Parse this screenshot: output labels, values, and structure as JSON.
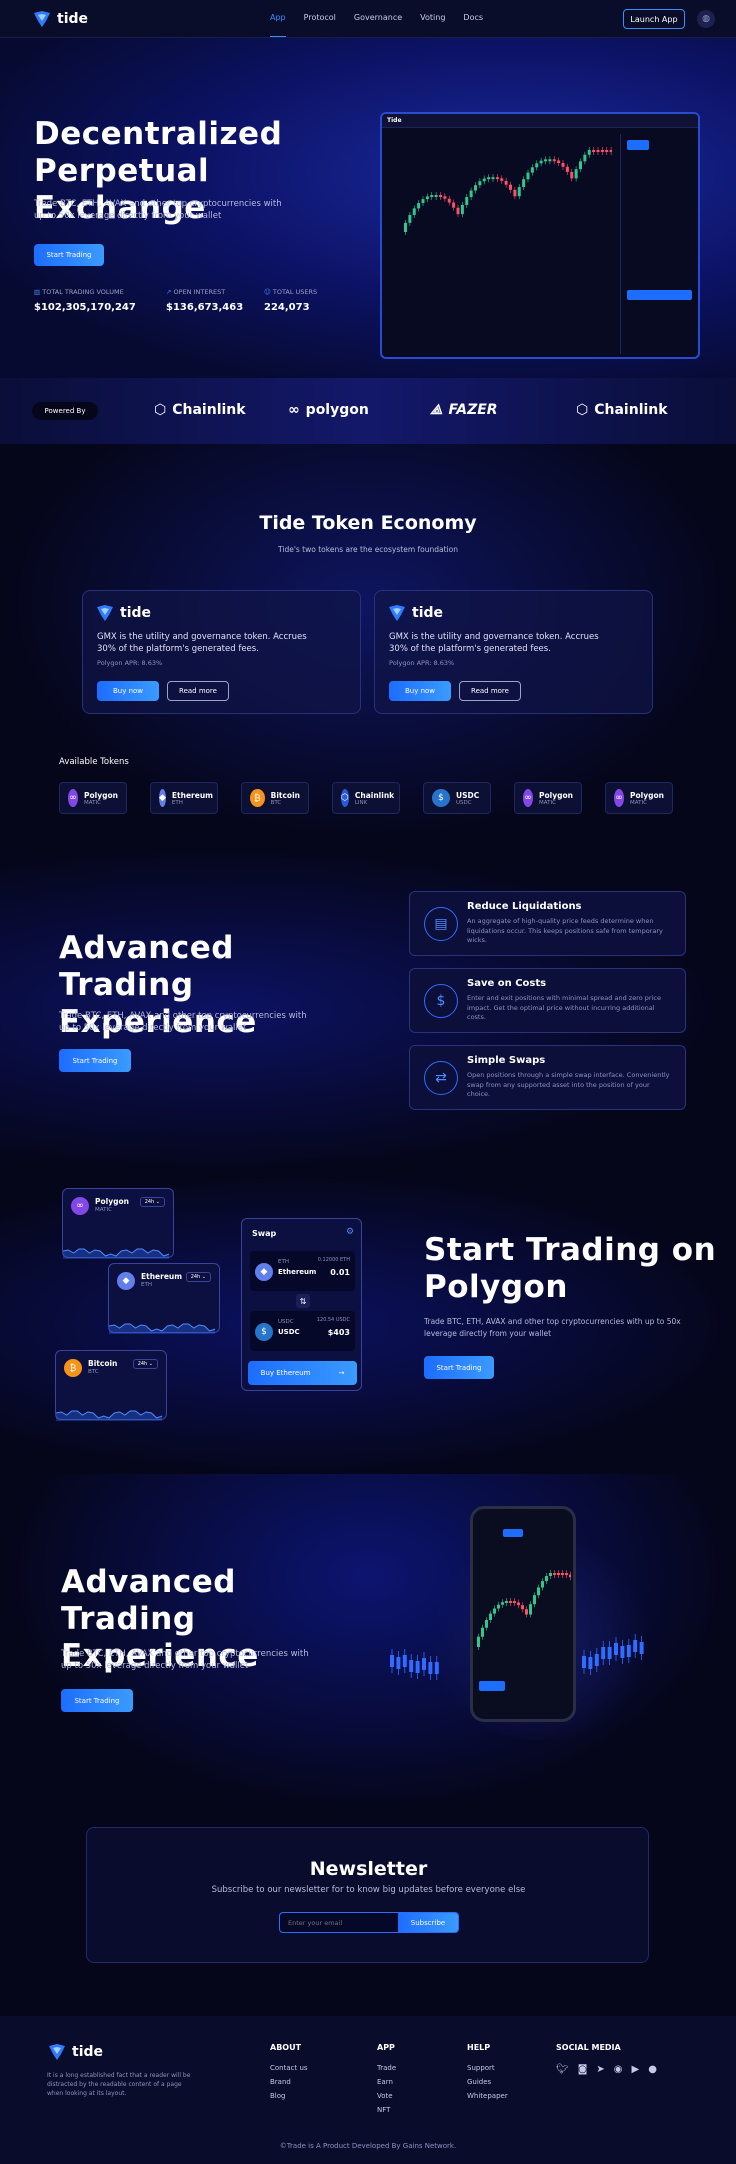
{
  "nav": {
    "brand": "tide",
    "links": [
      "App",
      "Protocol",
      "Governance",
      "Voting",
      "Docs"
    ],
    "launch": "Launch App"
  },
  "hero": {
    "title_line1": "Decentralized",
    "title_line2": "Perpetual Exchange",
    "subtitle": "Trade BTC, ETH, AVAX and other top cryptocurrencies with up to 50x leverage directly from your wallet",
    "cta": "Start Trading",
    "stats": [
      {
        "label": "TOTAL TRADING VOLUME",
        "value": "$102,305,170,247"
      },
      {
        "label": "OPEN INTEREST",
        "value": "$136,673,463"
      },
      {
        "label": "TOTAL USERS",
        "value": "224,073"
      }
    ]
  },
  "powered": {
    "label": "Powered By",
    "partners": [
      "Chainlink",
      "polygon",
      "FAZER",
      "Chainlink"
    ]
  },
  "economy": {
    "title": "Tide Token Economy",
    "subtitle": "Tide's two tokens are the ecosystem foundation",
    "cards": [
      {
        "brand": "tide",
        "desc_line1": "GMX is the utility and governance token. Accrues",
        "desc_line2": "30% of the platform's generated fees.",
        "apr": "Polygon APR: 8.63%",
        "buy": "Buy now",
        "read": "Read more"
      },
      {
        "brand": "tide",
        "desc_line1": "GMX is the utility and governance token. Accrues",
        "desc_line2": "30% of the platform's generated fees.",
        "apr": "Polygon APR: 8.63%",
        "buy": "Buy now",
        "read": "Read more"
      }
    ],
    "tokens_title": "Available Tokens",
    "tokens": [
      {
        "name": "Polygon",
        "sym": "MATIC",
        "color": "#8247e5"
      },
      {
        "name": "Ethereum",
        "sym": "ETH",
        "color": "#627eea"
      },
      {
        "name": "Bitcoin",
        "sym": "BTC",
        "color": "#f7931a"
      },
      {
        "name": "Chainlink",
        "sym": "LINK",
        "color": "#2a5ada"
      },
      {
        "name": "USDC",
        "sym": "USDC",
        "color": "#2775ca"
      },
      {
        "name": "Polygon",
        "sym": "MATIC",
        "color": "#8247e5"
      },
      {
        "name": "Polygon",
        "sym": "MATIC",
        "color": "#8247e5"
      }
    ]
  },
  "advanced": {
    "title_line1": "Advanced Trading",
    "title_line2": "Experience",
    "subtitle_line1": "Trade BTC, ETH, AVAX and other top cryptocurrencies with",
    "subtitle_line2": "up to 50x leverage directly from your wallet",
    "cta": "Start Trading",
    "features": [
      {
        "title": "Reduce Liquidations",
        "desc": "An aggregate of high-quality price feeds determine when liquidations occur. This keeps positions safe from temporary wicks."
      },
      {
        "title": "Save on Costs",
        "desc": "Enter and exit positions with minimal spread and zero price impact. Get the optimal price without incurring additional costs."
      },
      {
        "title": "Simple Swaps",
        "desc": "Open positions through a simple swap interface. Conveniently swap from any supported asset into the position of your choice."
      }
    ]
  },
  "polygon": {
    "title_line1": "Start Trading on",
    "title_line2": "Polygon",
    "subtitle_line1": "Trade BTC, ETH, AVAX and other top cryptocurrencies with up to 50x",
    "subtitle_line2": "leverage directly from your wallet",
    "cta": "Start Trading",
    "minis": [
      {
        "name": "Polygon",
        "sym": "MATIC",
        "tf": "24h"
      },
      {
        "name": "Ethereum",
        "sym": "ETH",
        "tf": "24h"
      },
      {
        "name": "Bitcoin",
        "sym": "BTC",
        "tf": "24h"
      }
    ],
    "swap": {
      "title": "Swap",
      "from_sym": "ETH",
      "from_name": "Ethereum",
      "from_bal": "0.12000 ETH",
      "from_amt": "0.01",
      "to_sym": "USDC",
      "to_name": "USDC",
      "to_bal": "120.54 USDC",
      "to_amt": "$403",
      "btn": "Buy Ethereum"
    }
  },
  "advanced2": {
    "title_line1": "Advanced Trading",
    "title_line2": "Experience",
    "subtitle_line1": "Trade BTC, ETH, AVAX and other top cryptocurrencies with",
    "subtitle_line2": "up to 50x leverage directly from your wallet",
    "cta": "Start Trading"
  },
  "newsletter": {
    "title": "Newsletter",
    "subtitle": "Subscribe to our newsletter for to know big updates before everyone else",
    "placeholder": "Enter your email",
    "btn": "Subscribe"
  },
  "footer": {
    "brand": "tide",
    "about_text_line1": "It is a long established fact that a reader will be",
    "about_text_line2": "distracted by the readable content of a page",
    "about_text_line3": "when looking at its layout.",
    "cols": [
      {
        "head": "ABOUT",
        "links": [
          "Contact us",
          "Brand",
          "Blog"
        ]
      },
      {
        "head": "APP",
        "links": [
          "Trade",
          "Earn",
          "Vote",
          "NFT"
        ]
      },
      {
        "head": "HELP",
        "links": [
          "Support",
          "Guides",
          "Whitepaper"
        ]
      },
      {
        "head": "SOCIAL MEDIA",
        "links": []
      }
    ],
    "copyright": "©Trade is A Product Developed By Gains Network."
  },
  "colors": {
    "accent": "#1d6dff",
    "bg": "#05061a"
  }
}
